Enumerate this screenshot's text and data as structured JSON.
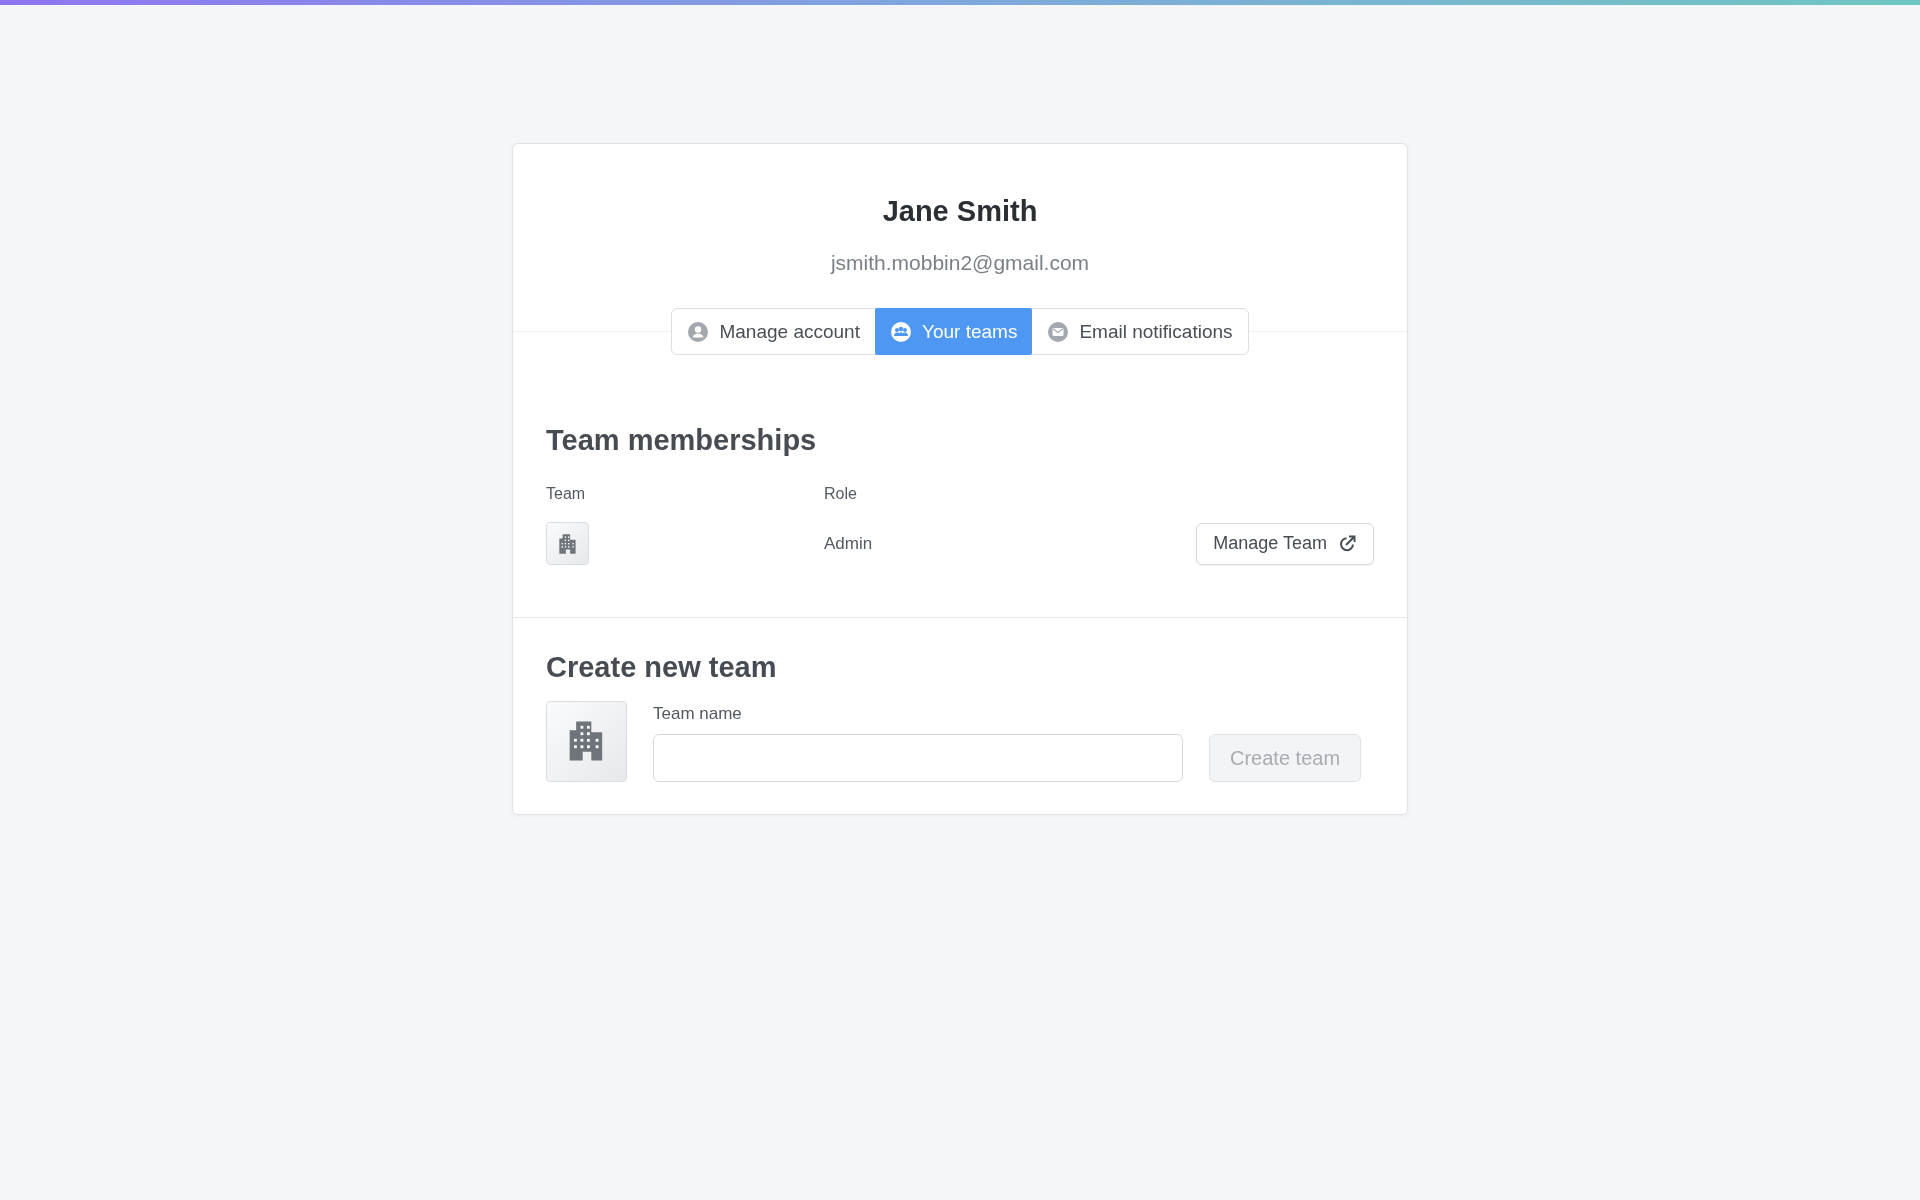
{
  "profile": {
    "name": "Jane Smith",
    "email": "jsmith.mobbin2@gmail.com"
  },
  "tabs": [
    {
      "label": "Manage account",
      "selected": false
    },
    {
      "label": "Your teams",
      "selected": true
    },
    {
      "label": "Email notifications",
      "selected": false
    }
  ],
  "memberships": {
    "title": "Team memberships",
    "columns": [
      "Team",
      "Role"
    ],
    "rows": [
      {
        "role": "Admin",
        "action": "Manage Team"
      }
    ]
  },
  "create_team": {
    "title": "Create new team",
    "field_label": "Team name",
    "button": "Create team",
    "button_disabled": true
  }
}
